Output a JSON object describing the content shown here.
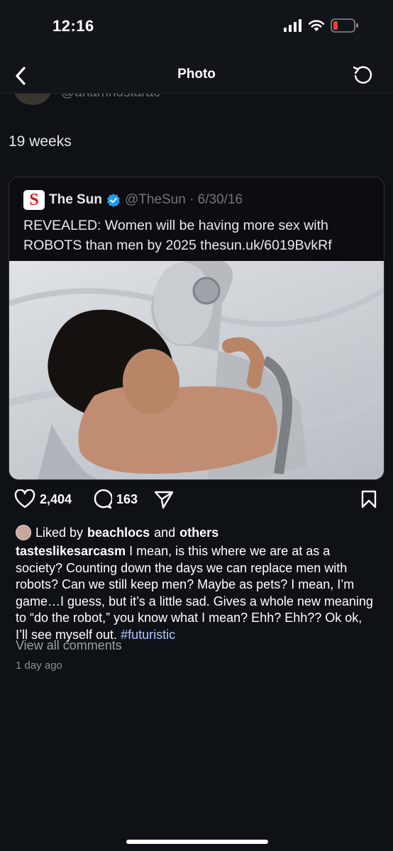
{
  "status_bar": {
    "time": "12:16",
    "icons": [
      "signal-icon",
      "wifi-icon",
      "battery-icon"
    ],
    "battery_color": "#ff3b30"
  },
  "nav": {
    "title": "Photo",
    "back_icon": "chevron-left-icon",
    "reload_icon": "reload-icon"
  },
  "previous_post": {
    "handle": "@anamnostarac"
  },
  "post": {
    "text": "19 weeks"
  },
  "quoted_tweet": {
    "logo_letter": "S",
    "name": "The Sun",
    "verified": true,
    "verified_color": "#1d9bf0",
    "handle_date": "@TheSun · 6/30/16",
    "text": "REVEALED: Women will be having more sex with ROBOTS than men by 2025 thesun.uk/6019BvkRf"
  },
  "actions": {
    "likes": "2,404",
    "comments": "163"
  },
  "liked_by": {
    "prefix": "Liked by",
    "user": "beachlocs",
    "and": "and",
    "others": "others"
  },
  "caption": {
    "username": "tasteslikesarcasm",
    "text": " I mean, is this where we are at as a society? Counting down the days we can replace men with robots? Can we still keep men? Maybe as pets? I mean, I’m game…I guess, but it’s a little sad. Gives a whole new meaning to “do the robot,” you know what I mean? Ehh? Ehh?? Ok ok, I’ll see myself out. ",
    "hashtag": "#futuristic"
  },
  "view_all_comments": "View all comments",
  "time_ago": "1 day ago"
}
